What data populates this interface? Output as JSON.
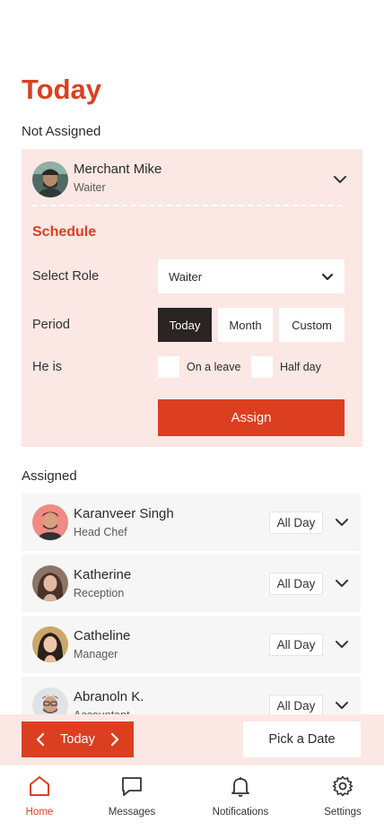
{
  "page": {
    "title": "Today"
  },
  "sections": {
    "not_assigned": "Not Assigned",
    "assigned": "Assigned"
  },
  "unassigned_card": {
    "name": "Merchant Mike",
    "role": "Waiter",
    "schedule_title": "Schedule",
    "select_role_label": "Select Role",
    "select_role_value": "Waiter",
    "period_label": "Period",
    "period_options": [
      "Today",
      "Month",
      "Custom"
    ],
    "period_selected": "Today",
    "he_is_label": "He is",
    "checkboxes": [
      {
        "label": "On a leave",
        "checked": false
      },
      {
        "label": "Half day",
        "checked": false
      }
    ],
    "assign_label": "Assign"
  },
  "assigned_list": [
    {
      "name": "Karanveer Singh",
      "role": "Head Chef",
      "shift": "All Day"
    },
    {
      "name": "Katherine",
      "role": "Reception",
      "shift": "All Day"
    },
    {
      "name": "Catheline",
      "role": "Manager",
      "shift": "All Day"
    },
    {
      "name": "Abranoln K.",
      "role": "Accountant",
      "shift": "All Day"
    }
  ],
  "date_bar": {
    "current": "Today",
    "pick_label": "Pick a Date"
  },
  "tabs": [
    {
      "label": "Home",
      "icon": "home-icon",
      "active": true
    },
    {
      "label": "Messages",
      "icon": "message-icon",
      "active": false
    },
    {
      "label": "Notifications",
      "icon": "bell-icon",
      "active": false
    },
    {
      "label": "Settings",
      "icon": "gear-icon",
      "active": false
    }
  ],
  "colors": {
    "accent": "#dc3f1f",
    "card_tint": "#fbe7e4",
    "dark_button": "#2a2423",
    "list_bg": "#f7f6f6"
  }
}
